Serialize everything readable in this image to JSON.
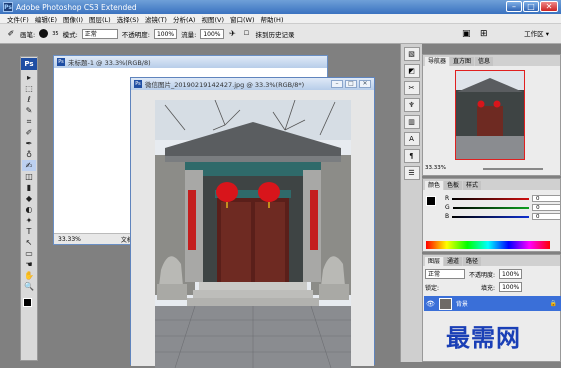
{
  "app": {
    "title": "Adobe Photoshop CS3 Extended",
    "icon_label": "Ps"
  },
  "menu": [
    "文件(F)",
    "编辑(E)",
    "图像(I)",
    "图层(L)",
    "选择(S)",
    "滤镜(T)",
    "分析(A)",
    "视图(V)",
    "窗口(W)",
    "帮助(H)"
  ],
  "options": {
    "brush_label": "画笔:",
    "brush_size": "35",
    "mode_label": "模式:",
    "mode_value": "正常",
    "opacity_label": "不透明度:",
    "opacity_value": "100%",
    "flow_label": "流量:",
    "flow_value": "100%",
    "history_label": "抹到历史记录",
    "workspace_label": "工作区 ▾"
  },
  "toolbox": {
    "logo": "Ps",
    "tools": [
      "▸",
      "⬚",
      "ℓ",
      "✎",
      "⌗",
      "✐",
      "✒",
      "♁",
      "✍",
      "◫",
      "▮",
      "◆",
      "◐",
      "✦",
      "T",
      "↖",
      "▭",
      "☚",
      "✋",
      "🔍"
    ]
  },
  "documents": {
    "back": {
      "title": "未标题-1 @ 33.3%(RGB/8)",
      "zoom": "33.33%",
      "status": "文档"
    },
    "front": {
      "title": "微信图片_20190219142427.jpg @ 33.3%(RGB/8*)"
    }
  },
  "navigator": {
    "tabs": [
      "导航器",
      "直方图",
      "信息"
    ],
    "zoom": "33.33%"
  },
  "color_panel": {
    "tabs": [
      "颜色",
      "色板",
      "样式"
    ],
    "channels": [
      {
        "label": "R",
        "value": "0",
        "color": "#d01010"
      },
      {
        "label": "G",
        "value": "0",
        "color": "#10a020"
      },
      {
        "label": "B",
        "value": "0",
        "color": "#1030d0"
      }
    ]
  },
  "layers_panel": {
    "tabs": [
      "图层",
      "通道",
      "路径"
    ],
    "blend_mode": "正常",
    "opacity_label": "不透明度:",
    "opacity_value": "100%",
    "lock_label": "锁定:",
    "fill_label": "填充:",
    "fill_value": "100%",
    "layer_name": "背景"
  },
  "watermark": "最需网"
}
